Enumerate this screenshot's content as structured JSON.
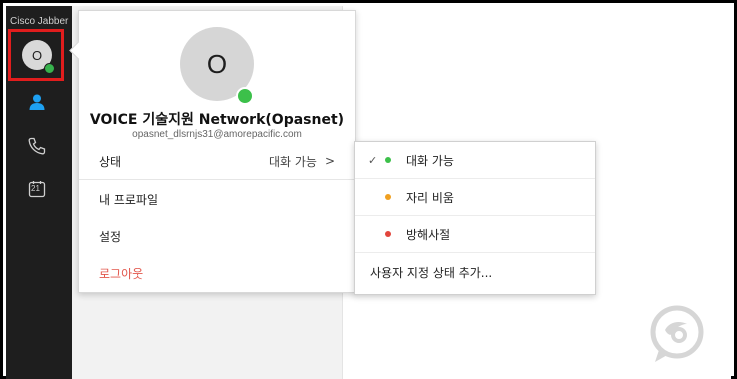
{
  "app": {
    "title": "Cisco Jabber"
  },
  "sidebar": {
    "avatar_initial": "O",
    "calendar_day": "21",
    "icons": [
      "contacts-icon",
      "phone-icon",
      "calendar-icon"
    ]
  },
  "profile": {
    "avatar_initial": "O",
    "name": "VOICE 기술지원 Network(Opasnet)",
    "email": "opasnet_dlsrnjs31@amorepacific.com",
    "status_label": "상태",
    "status_value": "대화 가능",
    "status_chevron": ">",
    "my_profile": "내 프로파일",
    "settings": "설정",
    "logout": "로그아웃"
  },
  "status_menu": {
    "items": [
      {
        "label": "대화 가능",
        "color": "#3cc04a",
        "checked": true
      },
      {
        "label": "자리 비움",
        "color": "#f0a020",
        "checked": false
      },
      {
        "label": "방해사절",
        "color": "#e2453c",
        "checked": false
      }
    ],
    "checkmark": "✓",
    "add_custom": "사용자 지정 상태 추가..."
  },
  "colors": {
    "sidebar": "#1e1e1e",
    "accent": "#1ea1f2",
    "highlight": "#e11d1d"
  }
}
